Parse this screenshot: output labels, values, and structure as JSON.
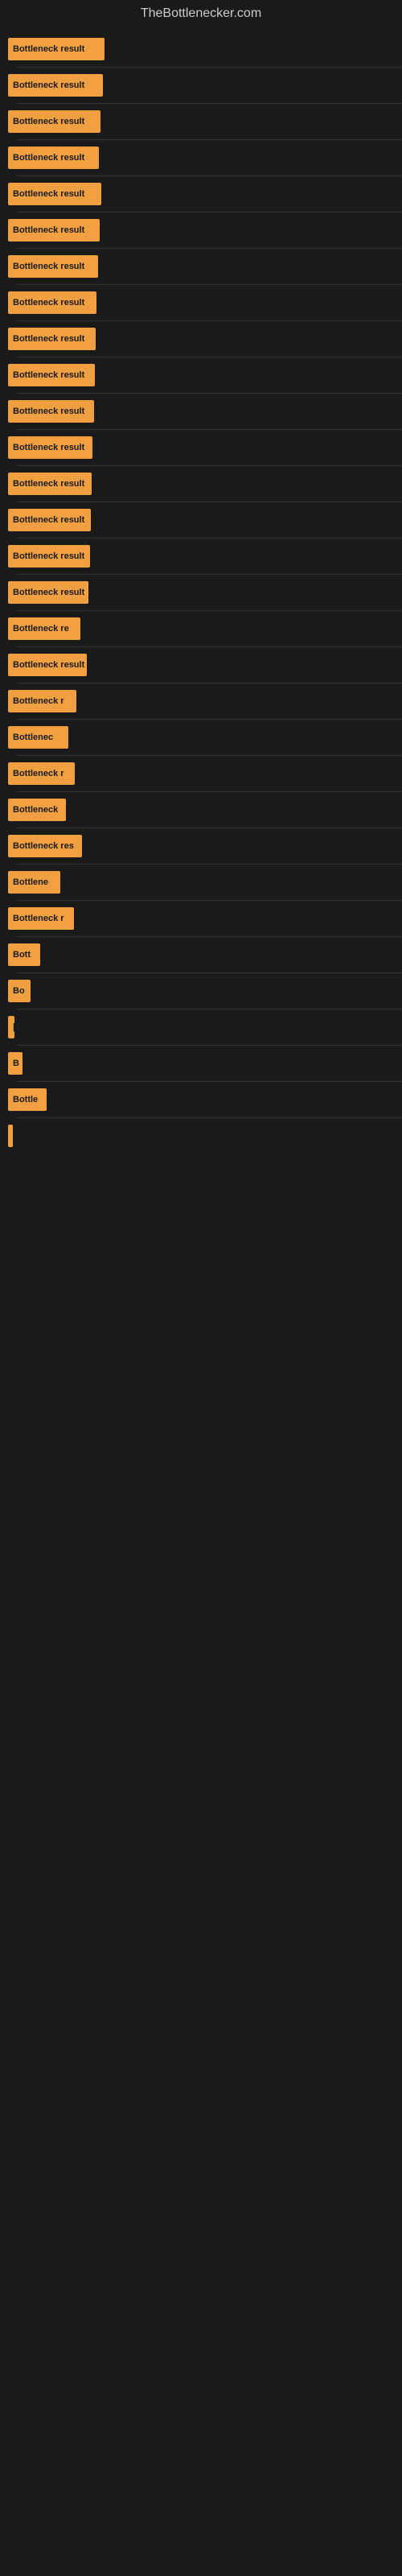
{
  "site_title": "TheBottlenecker.com",
  "bars": [
    {
      "label": "Bottleneck result",
      "width": 120
    },
    {
      "label": "Bottleneck result",
      "width": 118
    },
    {
      "label": "Bottleneck result",
      "width": 115
    },
    {
      "label": "Bottleneck result",
      "width": 113
    },
    {
      "label": "Bottleneck result",
      "width": 116
    },
    {
      "label": "Bottleneck result",
      "width": 114
    },
    {
      "label": "Bottleneck result",
      "width": 112
    },
    {
      "label": "Bottleneck result",
      "width": 110
    },
    {
      "label": "Bottleneck result",
      "width": 109
    },
    {
      "label": "Bottleneck result",
      "width": 108
    },
    {
      "label": "Bottleneck result",
      "width": 107
    },
    {
      "label": "Bottleneck result",
      "width": 105
    },
    {
      "label": "Bottleneck result",
      "width": 104
    },
    {
      "label": "Bottleneck result",
      "width": 103
    },
    {
      "label": "Bottleneck result",
      "width": 102
    },
    {
      "label": "Bottleneck result",
      "width": 100
    },
    {
      "label": "Bottleneck re",
      "width": 90
    },
    {
      "label": "Bottleneck result",
      "width": 98
    },
    {
      "label": "Bottleneck r",
      "width": 85
    },
    {
      "label": "Bottlenec",
      "width": 75
    },
    {
      "label": "Bottleneck r",
      "width": 83
    },
    {
      "label": "Bottleneck",
      "width": 72
    },
    {
      "label": "Bottleneck res",
      "width": 92
    },
    {
      "label": "Bottlene",
      "width": 65
    },
    {
      "label": "Bottleneck r",
      "width": 82
    },
    {
      "label": "Bott",
      "width": 40
    },
    {
      "label": "Bo",
      "width": 28
    },
    {
      "label": "|",
      "width": 8
    },
    {
      "label": "B",
      "width": 18
    },
    {
      "label": "Bottle",
      "width": 48
    },
    {
      "label": "|",
      "width": 6
    }
  ]
}
